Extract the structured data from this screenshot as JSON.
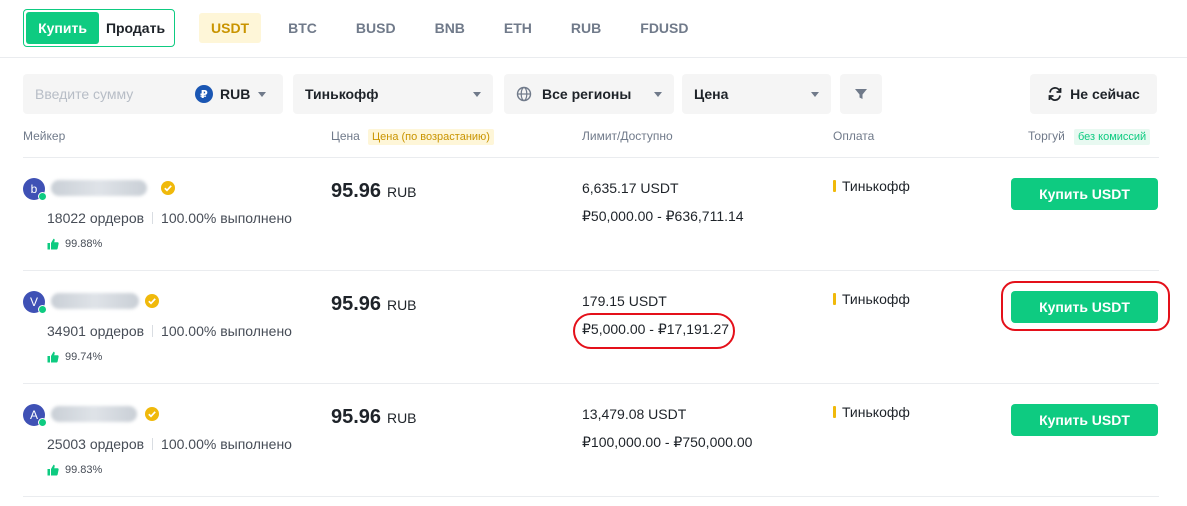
{
  "trade_switch": {
    "buy": "Купить",
    "sell": "Продать"
  },
  "assets": [
    "USDT",
    "BTC",
    "BUSD",
    "BNB",
    "ETH",
    "RUB",
    "FDUSD"
  ],
  "active_asset": "USDT",
  "filters": {
    "amount_placeholder": "Введите сумму",
    "currency_icon": "₽",
    "currency": "RUB",
    "bank": "Тинькофф",
    "region": "Все регионы",
    "sort": "Цена",
    "not_now": "Не сейчас"
  },
  "table_header": {
    "maker": "Мейкер",
    "price": "Цена",
    "price_tag": "Цена (по возрастанию)",
    "limit": "Лимит/Доступно",
    "payment": "Оплата",
    "trade": "Торгуй",
    "trade_tag": "без комиссий"
  },
  "rows": [
    {
      "initial": "b",
      "orders": "18022 ордеров",
      "completion": "100.00% выполнено",
      "rating": "99.88%",
      "price": "95.96",
      "price_unit": "RUB",
      "available": "6,635.17 USDT",
      "limit": "₽50,000.00 - ₽636,711.14",
      "payment": "Тинькофф",
      "button": "Купить USDT"
    },
    {
      "initial": "V",
      "orders": "34901 ордеров",
      "completion": "100.00% выполнено",
      "rating": "99.74%",
      "price": "95.96",
      "price_unit": "RUB",
      "available": "179.15 USDT",
      "limit": "₽5,000.00 - ₽17,191.27",
      "payment": "Тинькофф",
      "button": "Купить USDT"
    },
    {
      "initial": "A",
      "orders": "25003 ордеров",
      "completion": "100.00% выполнено",
      "rating": "99.83%",
      "price": "95.96",
      "price_unit": "RUB",
      "available": "13,479.08 USDT",
      "limit": "₽100,000.00 - ₽750,000.00",
      "payment": "Тинькофф",
      "button": "Купить USDT"
    }
  ],
  "colors": {
    "accent_green": "#0ecb81",
    "accent_yellow": "#f0b90b",
    "highlight_red": "#e4101a"
  }
}
